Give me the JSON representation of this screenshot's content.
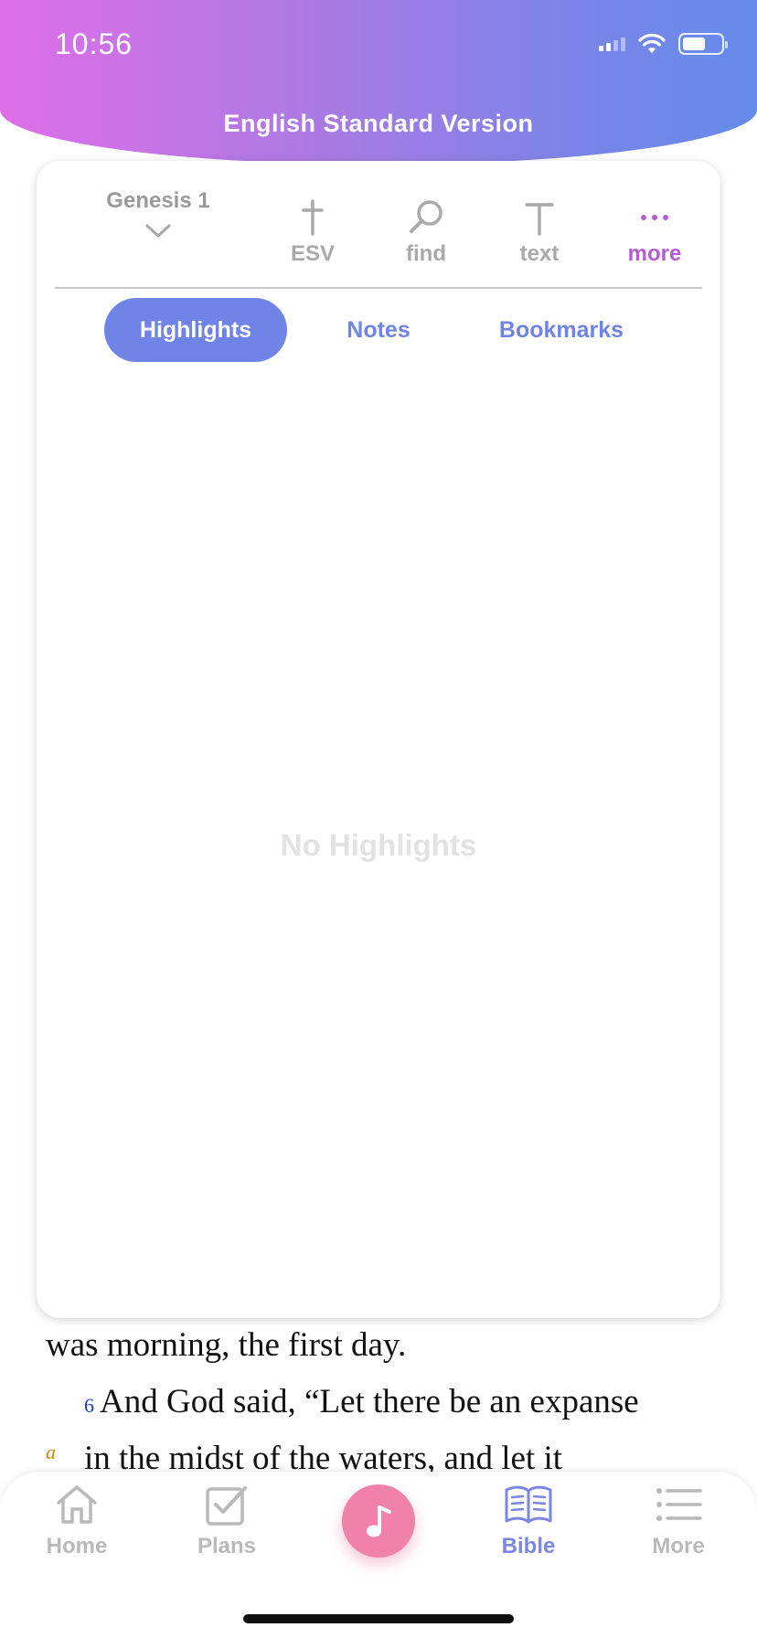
{
  "status_bar": {
    "time": "10:56"
  },
  "header": {
    "title": "English Standard Version"
  },
  "toolbar": {
    "chapter": "Genesis 1",
    "buttons": [
      {
        "id": "version",
        "label": "ESV",
        "icon": "cross-icon"
      },
      {
        "id": "find",
        "label": "find",
        "icon": "search-icon"
      },
      {
        "id": "text",
        "label": "text",
        "icon": "text-icon"
      },
      {
        "id": "more",
        "label": "more",
        "icon": "ellipsis-icon"
      }
    ]
  },
  "tabs": [
    {
      "label": "Highlights",
      "active": true
    },
    {
      "label": "Notes",
      "active": false
    },
    {
      "label": "Bookmarks",
      "active": false
    }
  ],
  "empty_state": "No Highlights",
  "scripture": {
    "line1": "was morning, the first day.",
    "verse_number": "6",
    "line2": "And God said, “Let there be an expanse",
    "footnote": "a",
    "line3": "in the midst of the waters, and let it"
  },
  "tabbar": {
    "items": [
      {
        "label": "Home",
        "icon": "home-icon",
        "active": false
      },
      {
        "label": "Plans",
        "icon": "checkbox-icon",
        "active": false
      },
      {
        "label": "",
        "icon": "music-note-icon",
        "active": false
      },
      {
        "label": "Bible",
        "icon": "bible-icon",
        "active": true
      },
      {
        "label": "More",
        "icon": "list-icon",
        "active": false
      }
    ]
  },
  "colors": {
    "accent": "#6f84e6",
    "more_accent": "#b45bd6",
    "music_button": "#f081a8",
    "header_gradient_start": "#de6ee8",
    "header_gradient_end": "#648bea"
  }
}
